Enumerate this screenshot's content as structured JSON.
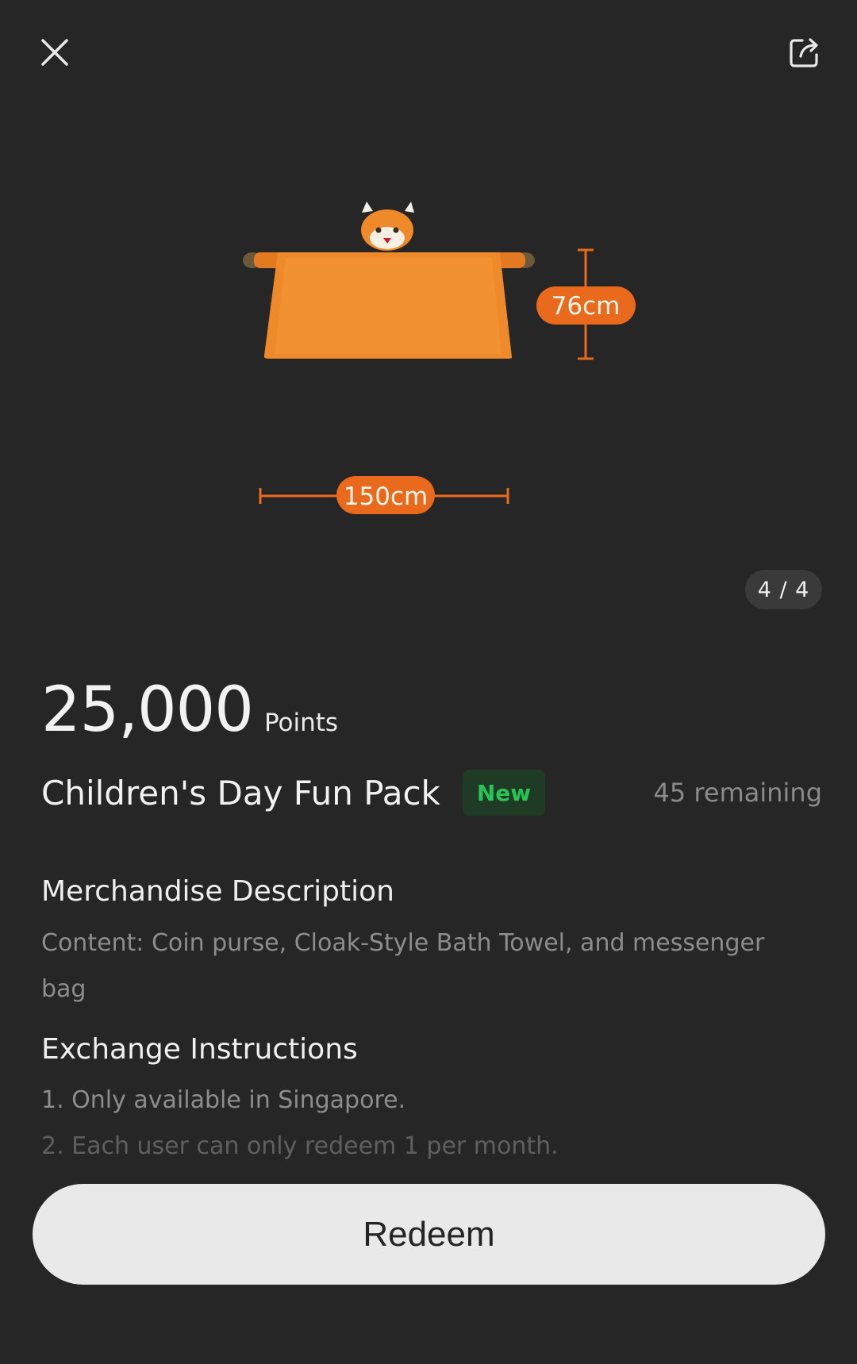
{
  "header": {
    "close_icon": "close-icon",
    "share_icon": "share-icon"
  },
  "gallery": {
    "counter": "4 / 4",
    "dimension_height": "76cm",
    "dimension_width": "150cm",
    "accent_color": "#e96a1d"
  },
  "product": {
    "price": "25,000",
    "price_unit": "Points",
    "title": "Children's Day Fun Pack",
    "badge": "New",
    "badge_color": "#28c455",
    "remaining": "45 remaining"
  },
  "description": {
    "heading": "Merchandise Description",
    "text": "Content: Coin purse, Cloak-Style Bath Towel, and messenger bag"
  },
  "instructions": {
    "heading": "Exchange Instructions",
    "items": [
      "1. Only available in Singapore.",
      "2. Each user can only redeem 1 per month."
    ]
  },
  "actions": {
    "redeem_label": "Redeem"
  }
}
